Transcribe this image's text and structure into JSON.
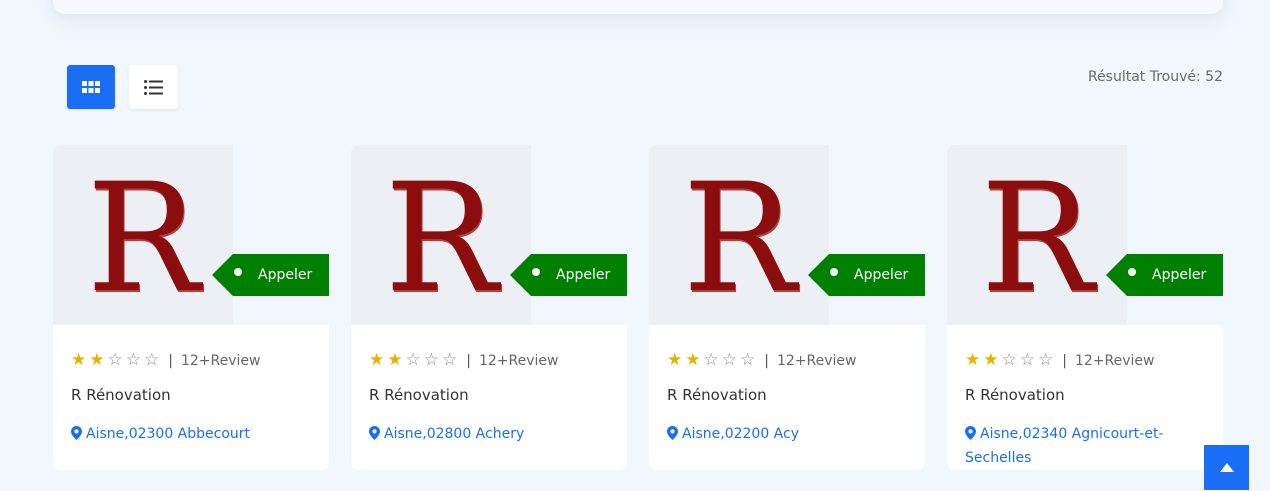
{
  "toolbar": {
    "grid_view_icon": "grid-icon",
    "list_view_icon": "list-icon",
    "result_text": "Résultat Trouvé: 52"
  },
  "colors": {
    "accent": "#1a6df5",
    "call": "#008000",
    "star": "#e5b300",
    "logo": "#8b0d0d"
  },
  "cards": [
    {
      "logo_letter": "R",
      "call_label": "Appeler",
      "rating": 2,
      "review": "12+Review",
      "name": "R Rénovation",
      "location": "Aisne,02300 Abbecourt"
    },
    {
      "logo_letter": "R",
      "call_label": "Appeler",
      "rating": 2,
      "review": "12+Review",
      "name": "R Rénovation",
      "location": "Aisne,02800 Achery"
    },
    {
      "logo_letter": "R",
      "call_label": "Appeler",
      "rating": 2,
      "review": "12+Review",
      "name": "R Rénovation",
      "location": "Aisne,02200 Acy"
    },
    {
      "logo_letter": "R",
      "call_label": "Appeler",
      "rating": 2,
      "review": "12+Review",
      "name": "R Rénovation",
      "location": "Aisne,02340 Agnicourt-et-Sechelles"
    }
  ],
  "review_separator": "|",
  "scroll_top_icon": "arrow-up-icon"
}
